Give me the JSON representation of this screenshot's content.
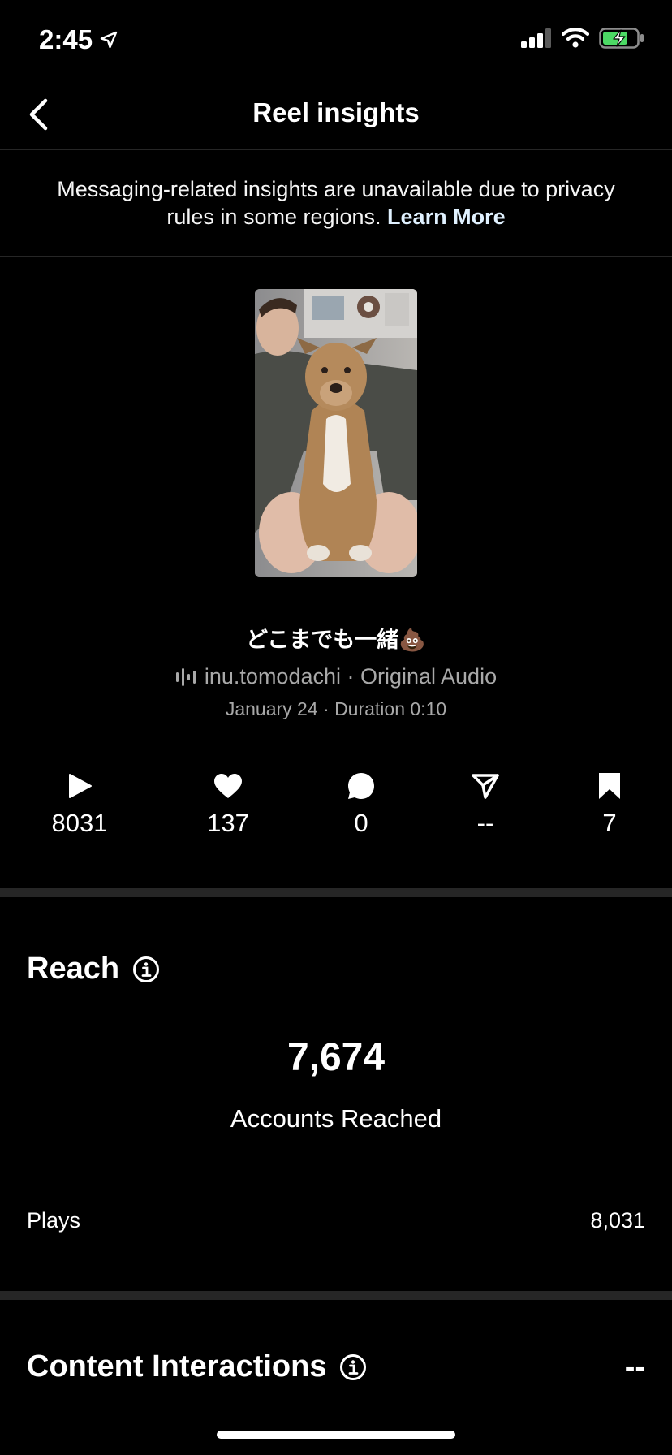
{
  "status": {
    "time": "2:45"
  },
  "nav": {
    "title": "Reel insights"
  },
  "notice": {
    "text": "Messaging-related insights are unavailable due to privacy rules in some regions.",
    "link": "Learn More"
  },
  "reel": {
    "caption": "どこまでも一緒💩",
    "audio": "inu.tomodachi · Original Audio",
    "meta": "January 24 · Duration 0:10"
  },
  "stats": {
    "plays": "8031",
    "likes": "137",
    "comments": "0",
    "shares": "--",
    "saves": "7"
  },
  "reach": {
    "title": "Reach",
    "number": "7,674",
    "label": "Accounts Reached",
    "plays_label": "Plays",
    "plays_value": "8,031"
  },
  "content_interactions": {
    "title": "Content Interactions",
    "value": "--"
  },
  "colors": {
    "background": "#000000",
    "divider": "#262626",
    "muted_text": "#a8a8a8",
    "battery_charging": "#4cd964"
  }
}
